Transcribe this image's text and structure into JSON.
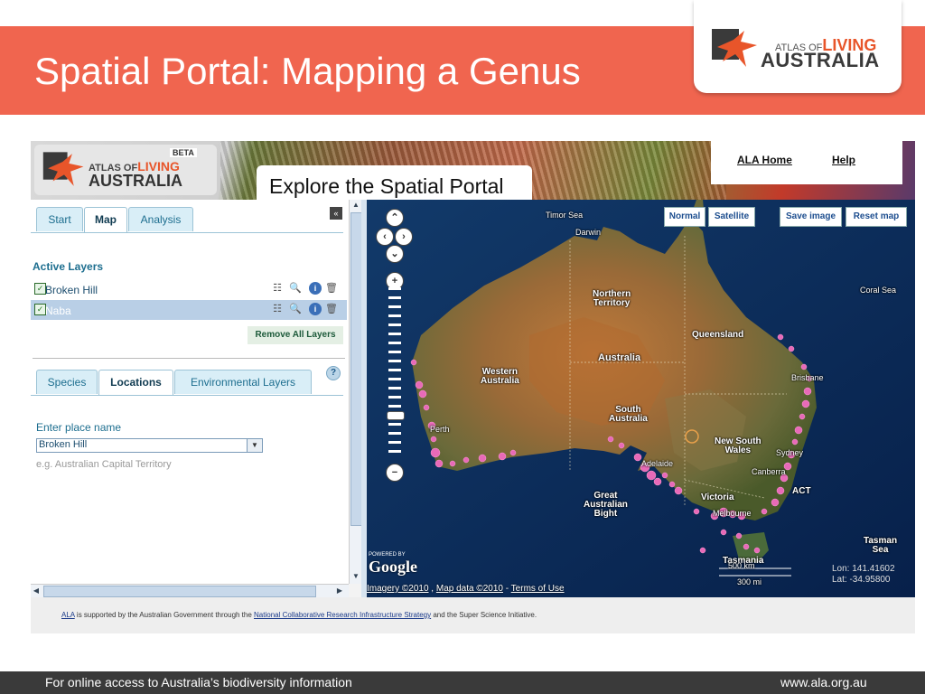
{
  "slide": {
    "title": "Spatial Portal: Mapping a Genus",
    "logo": {
      "atlas_of": "ATLAS OF",
      "living": "LIVING",
      "australia": "AUSTRALIA"
    }
  },
  "banner": {
    "logo": {
      "beta": "BETA",
      "atlas_of": "ATLAS OF",
      "living": "LIVING",
      "australia": "AUSTRALIA"
    },
    "explore_title": "Explore the Spatial Portal",
    "links": {
      "ala_home": "ALA Home",
      "help": "Help"
    }
  },
  "left_panel": {
    "tabs": [
      "Start",
      "Map",
      "Analysis"
    ],
    "active_tab": "Map",
    "collapse_icon": "«",
    "active_layers_heading": "Active Layers",
    "layers": [
      {
        "name": "Broken Hill",
        "checked": true,
        "selected": false
      },
      {
        "name": "Naba",
        "checked": true,
        "selected": true
      }
    ],
    "remove_all_label": "Remove All Layers",
    "lower_tabs": [
      "Species",
      "Locations",
      "Environmental Layers"
    ],
    "lower_active_tab": "Locations",
    "place_label": "Enter place name",
    "place_value": "Broken Hill",
    "place_hint": "e.g. Australian Capital Territory"
  },
  "map": {
    "buttons": {
      "normal": "Normal",
      "satellite": "Satellite",
      "save_image": "Save image",
      "reset_map": "Reset map"
    },
    "labels": {
      "timor_sea": "Timor Sea",
      "darwin": "Darwin",
      "coral_sea": "Coral Sea",
      "northern_territory": "Northern\nTerritory",
      "queensland": "Queensland",
      "australia": "Australia",
      "western_australia": "Western\nAustralia",
      "south_australia": "South\nAustralia",
      "brisbane": "Brisbane",
      "perth": "Perth",
      "new_south_wales": "New South\nWales",
      "sydney": "Sydney",
      "adelaide": "Adelaide",
      "canberra": "Canberra",
      "act": "ACT",
      "great_australian_bight": "Great\nAustralian\nBight",
      "victoria": "Victoria",
      "melbourne": "Melbourne",
      "tasman_sea": "Tasman\nSea",
      "tasmania": "Tasmania"
    },
    "scale": {
      "km": "500 km",
      "mi": "300 mi"
    },
    "coords": {
      "lon": "Lon: 141.41602",
      "lat": "Lat: -34.95800"
    },
    "powered_by": "POWERED BY",
    "google": "Google",
    "attribution": {
      "imagery": "Imagery ©2010",
      "map_data": "Map data ©2010",
      "terms": "Terms of Use"
    },
    "colors": {
      "ocean": "#0b2a55",
      "land": "#8a6a3a",
      "points": "#e86ab8"
    }
  },
  "shot_footer": {
    "ala": "ALA",
    "text1": " is supported by the Australian Government through the ",
    "ncris": "National Collaborative Research Infrastructure Strategy",
    "text2": " and the Super Science Initiative."
  },
  "bottom_bar": {
    "left": "For online access to Australia’s biodiversity information",
    "right": "www.ala.org.au"
  }
}
